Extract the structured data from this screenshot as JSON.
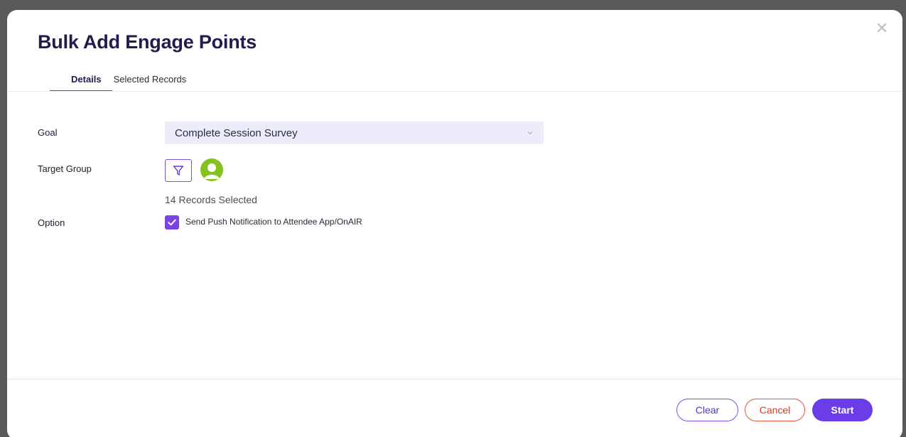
{
  "modal": {
    "title": "Bulk Add Engage Points",
    "close_icon": "close-icon"
  },
  "tabs": [
    {
      "label": "Details",
      "active": true
    },
    {
      "label": "Selected Records",
      "active": false
    }
  ],
  "form": {
    "goal": {
      "label": "Goal",
      "value": "Complete Session Survey",
      "icon": "chevron-down-icon"
    },
    "target_group": {
      "label": "Target Group",
      "filter_icon": "filter-icon",
      "avatar_icon": "user-avatar-icon",
      "records_selected": "14 Records Selected"
    },
    "option": {
      "label": "Option",
      "checkbox_checked": true,
      "checkbox_label": "Send Push Notification to Attendee App/OnAIR"
    }
  },
  "footer": {
    "clear_label": "Clear",
    "cancel_label": "Cancel",
    "start_label": "Start"
  },
  "colors": {
    "accent": "#6a3de8",
    "title": "#1f1d4d",
    "danger": "#e2533c",
    "avatar": "#86c21e",
    "select_bg": "#ececfa"
  }
}
